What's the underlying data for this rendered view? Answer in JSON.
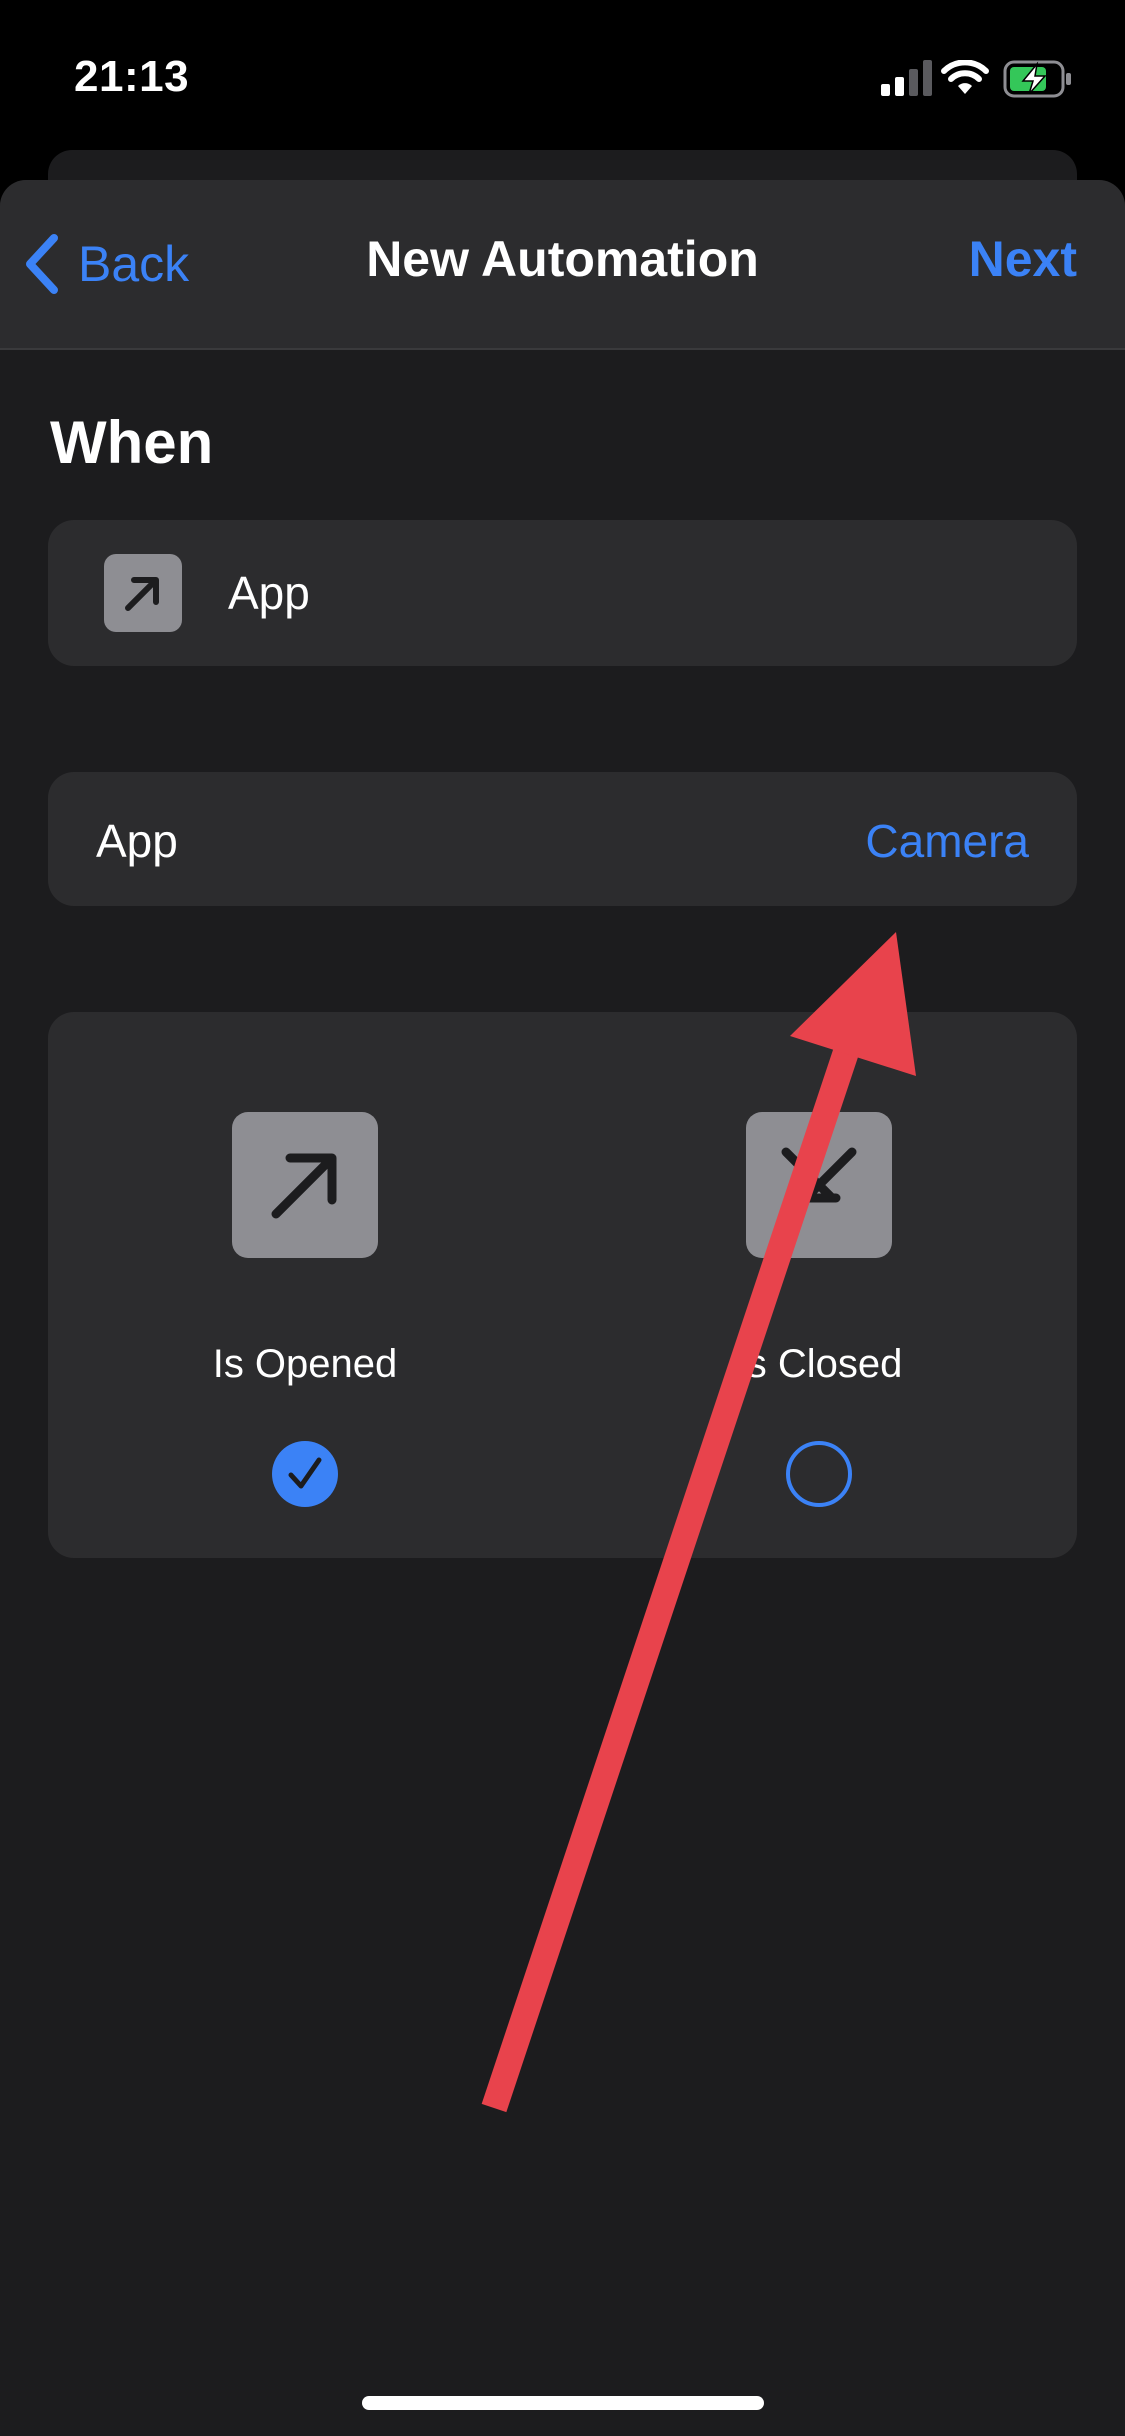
{
  "status_bar": {
    "time": "21:13"
  },
  "nav": {
    "back_label": "Back",
    "title": "New Automation",
    "next_label": "Next"
  },
  "section": {
    "heading": "When"
  },
  "trigger": {
    "label": "App",
    "icon": "arrow-up-right-icon"
  },
  "app_row": {
    "label": "App",
    "value": "Camera"
  },
  "options": [
    {
      "label": "Is Opened",
      "icon": "arrow-up-right-icon",
      "selected": true
    },
    {
      "label": "Is Closed",
      "icon": "arrow-down-left-x-icon",
      "selected": false
    }
  ],
  "colors": {
    "accent": "#3b82f6",
    "sheet_background": "#1c1c1e",
    "card_background": "#2c2c2e",
    "icon_tile": "#8e8e93",
    "annotation_arrow": "#e8434c",
    "battery_charging": "#34c759"
  }
}
